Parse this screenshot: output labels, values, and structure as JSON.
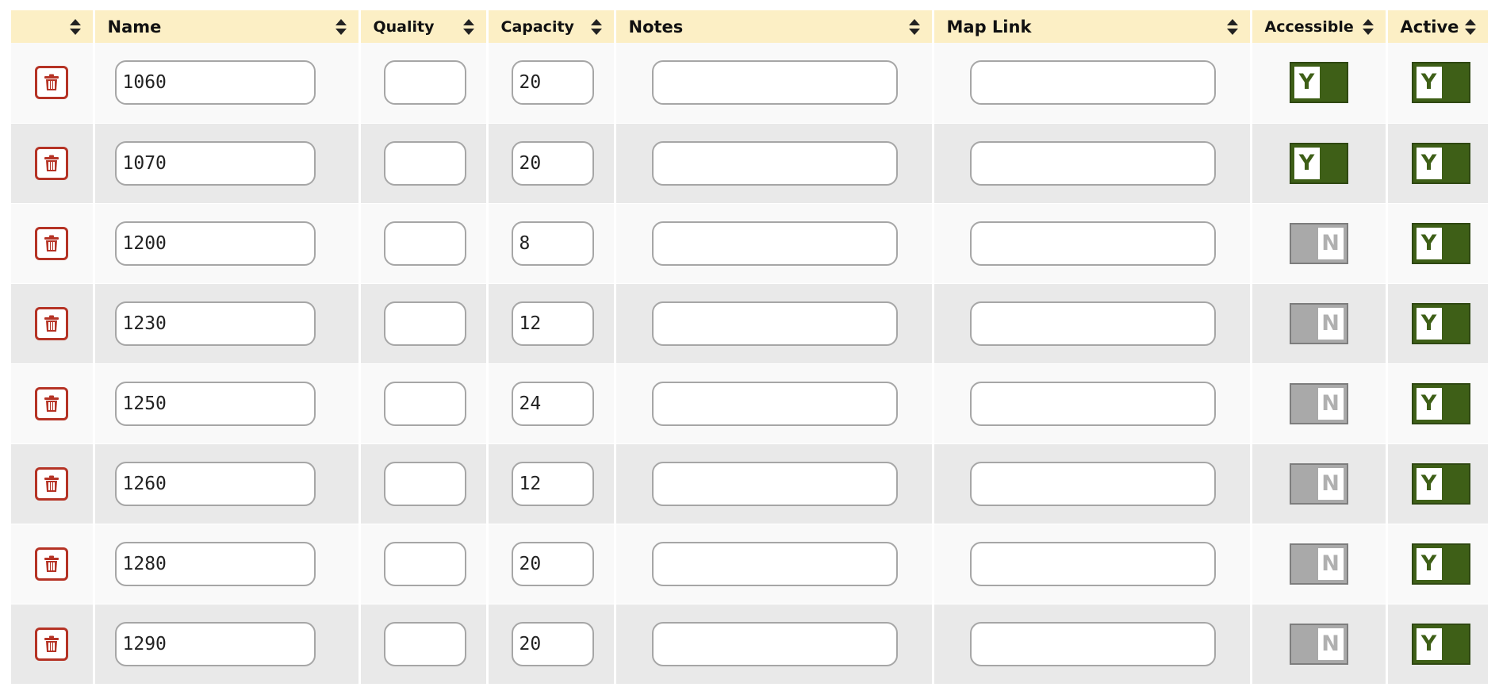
{
  "columns": [
    {
      "key": "delete",
      "label": ""
    },
    {
      "key": "name",
      "label": "Name"
    },
    {
      "key": "quality",
      "label": "Quality"
    },
    {
      "key": "capacity",
      "label": "Capacity"
    },
    {
      "key": "notes",
      "label": "Notes"
    },
    {
      "key": "map_link",
      "label": "Map Link"
    },
    {
      "key": "accessible",
      "label": "Accessible"
    },
    {
      "key": "active",
      "label": "Active"
    }
  ],
  "icons": {
    "sort": "sort-arrows-icon",
    "delete": "trash-icon"
  },
  "colors": {
    "header_bg": "#fcefc5",
    "row_odd": "#f9f9f9",
    "row_even": "#e9e9e9",
    "delete_red": "#b53325",
    "toggle_on": "#3e5f17",
    "toggle_off": "#a9a9a9"
  },
  "toggle_labels": {
    "on": "Y",
    "off": "N"
  },
  "rows": [
    {
      "name": "1060",
      "quality": "",
      "capacity": "20",
      "notes": "",
      "map_link": "",
      "accessible": true,
      "active": true
    },
    {
      "name": "1070",
      "quality": "",
      "capacity": "20",
      "notes": "",
      "map_link": "",
      "accessible": true,
      "active": true
    },
    {
      "name": "1200",
      "quality": "",
      "capacity": "8",
      "notes": "",
      "map_link": "",
      "accessible": false,
      "active": true
    },
    {
      "name": "1230",
      "quality": "",
      "capacity": "12",
      "notes": "",
      "map_link": "",
      "accessible": false,
      "active": true
    },
    {
      "name": "1250",
      "quality": "",
      "capacity": "24",
      "notes": "",
      "map_link": "",
      "accessible": false,
      "active": true
    },
    {
      "name": "1260",
      "quality": "",
      "capacity": "12",
      "notes": "",
      "map_link": "",
      "accessible": false,
      "active": true
    },
    {
      "name": "1280",
      "quality": "",
      "capacity": "20",
      "notes": "",
      "map_link": "",
      "accessible": false,
      "active": true
    },
    {
      "name": "1290",
      "quality": "",
      "capacity": "20",
      "notes": "",
      "map_link": "",
      "accessible": false,
      "active": true
    }
  ]
}
